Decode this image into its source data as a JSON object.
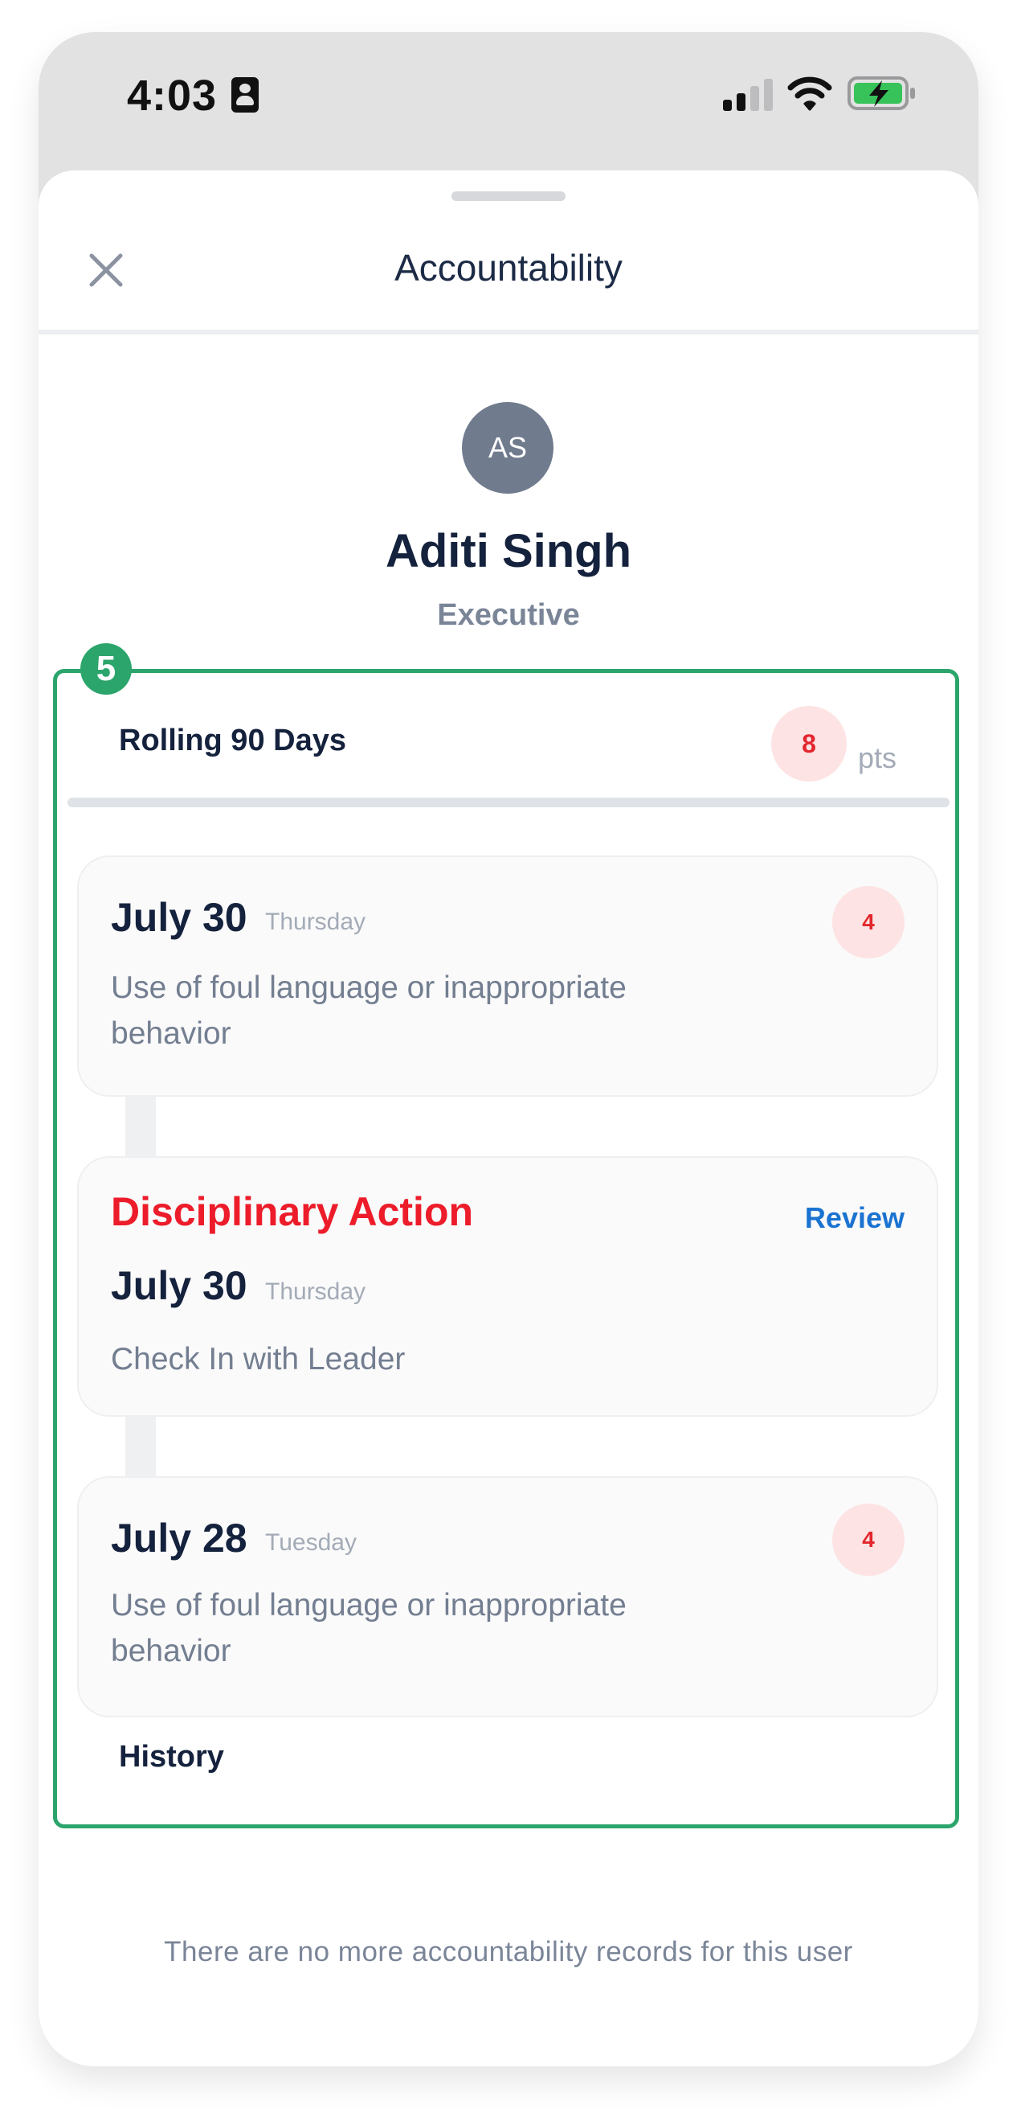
{
  "status_bar": {
    "time": "4:03",
    "icons": [
      "sim-card-icon",
      "signal-icon",
      "wifi-icon",
      "battery-charging-icon"
    ]
  },
  "header": {
    "title": "Accountability",
    "close_icon": "close-icon"
  },
  "profile": {
    "initials": "AS",
    "name": "Aditi Singh",
    "role": "Executive"
  },
  "highlight": {
    "step": "5",
    "color": "#2ba56b"
  },
  "rolling": {
    "label": "Rolling 90 Days",
    "points": "8",
    "unit": "pts"
  },
  "records": [
    {
      "type": "incident",
      "date": "July 30",
      "day": "Thursday",
      "description": "Use of foul language or inappropriate behavior",
      "points": "4"
    },
    {
      "type": "disciplinary",
      "title": "Disciplinary Action",
      "action_label": "Review",
      "date": "July 30",
      "day": "Thursday",
      "description": "Check In with Leader"
    },
    {
      "type": "incident",
      "date": "July 28",
      "day": "Tuesday",
      "description": "Use of foul language or inappropriate behavior",
      "points": "4"
    }
  ],
  "history": {
    "label": "History",
    "empty_message": "There are no more accountability records for this user"
  },
  "colors": {
    "accent_red": "#ed1c2a",
    "link_blue": "#1b73d1",
    "points_bg": "#fde3e3",
    "text_dark": "#15223d",
    "text_muted": "#737e91"
  }
}
